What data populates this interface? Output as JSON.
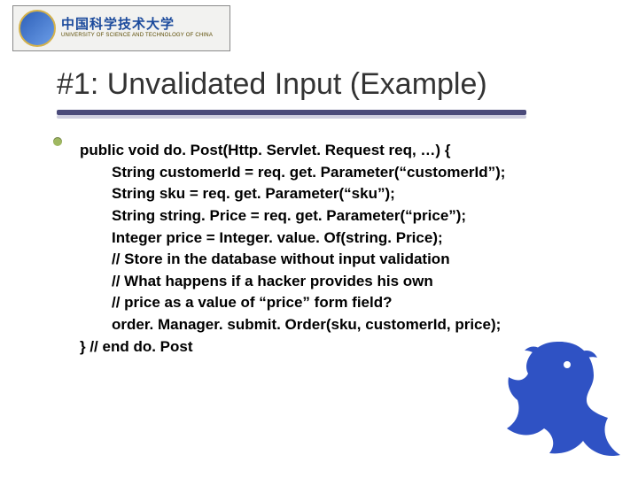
{
  "logo": {
    "name_cn": "中国科学技术大学",
    "name_en": "UNIVERSITY OF SCIENCE AND TECHNOLOGY OF CHINA"
  },
  "title": "#1: Unvalidated Input (Example)",
  "code": {
    "l1": "public void do. Post(Http. Servlet. Request req, …) {",
    "l2": "String customerId = req. get. Parameter(“customerId”);",
    "l3": "String sku = req. get. Parameter(“sku”);",
    "l4": "String string. Price = req. get. Parameter(“price”);",
    "l5": "Integer price = Integer. value. Of(string. Price);",
    "l6": "// Store in the database without input validation",
    "l7": "// What happens if a hacker provides his own",
    "l8": "// price as a value of “price” form field?",
    "l9": "order. Manager. submit. Order(sku, customerId, price);",
    "l10": "} // end do. Post"
  }
}
